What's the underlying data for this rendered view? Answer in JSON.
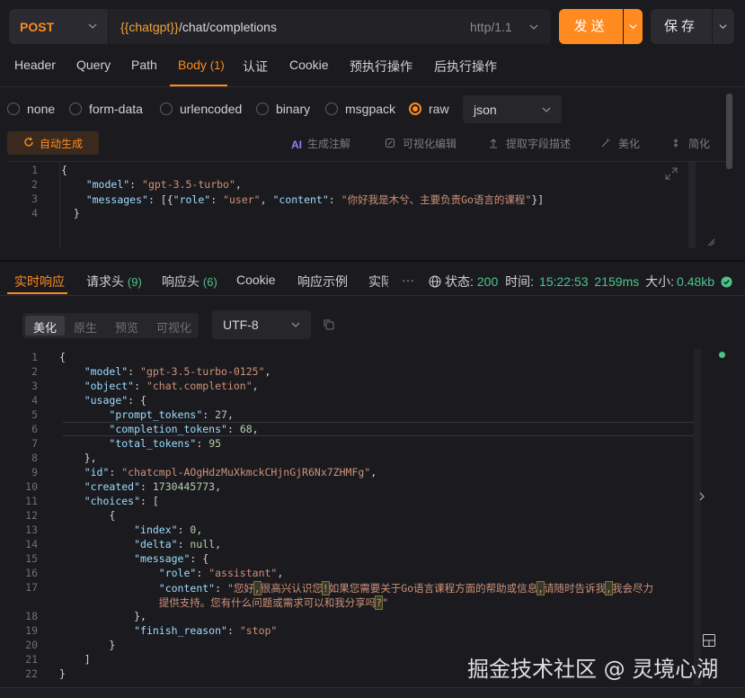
{
  "request": {
    "method": "POST",
    "url_variable": "{{chatgpt}}",
    "url_path": "/chat/completions",
    "http_version": "http/1.1",
    "send_label": "发送",
    "save_label": "保存"
  },
  "request_tabs": [
    {
      "label": "Header"
    },
    {
      "label": "Query"
    },
    {
      "label": "Path"
    },
    {
      "label": "Body",
      "count": "(1)",
      "active": true
    },
    {
      "label": "认证"
    },
    {
      "label": "Cookie"
    },
    {
      "label": "预执行操作"
    },
    {
      "label": "后执行操作"
    }
  ],
  "body_types": [
    "none",
    "form-data",
    "urlencoded",
    "binary",
    "msgpack",
    "raw"
  ],
  "body_type_selected": "raw",
  "body_format": "json",
  "body_tools": {
    "auto_generate": "自动生成",
    "ai_annotate": "生成注解",
    "visual_edit": "可视化编辑",
    "extract_fields": "提取字段描述",
    "beautify": "美化",
    "minify": "简化"
  },
  "request_body_lines": [
    {
      "n": "1",
      "html": "<span class='p'>{</span>"
    },
    {
      "n": "2",
      "html": "    <span class='k'>\"model\"</span><span class='p'>: </span><span class='s'>\"gpt-3.5-turbo\"</span><span class='p'>,</span>"
    },
    {
      "n": "3",
      "html": "    <span class='k'>\"messages\"</span><span class='p'>: [{</span><span class='k'>\"role\"</span><span class='p'>: </span><span class='s'>\"user\"</span><span class='p'>, </span><span class='k'>\"content\"</span><span class='p'>: </span><span class='s'>\"你好我是木兮、主要负责Go语言的课程\"</span><span class='p'>}]</span>"
    },
    {
      "n": "4",
      "html": "  <span class='p'>}</span>"
    }
  ],
  "response_tabs": [
    {
      "label": "实时响应",
      "active": true
    },
    {
      "label": "请求头",
      "count": "(9)"
    },
    {
      "label": "响应头",
      "count": "(6)"
    },
    {
      "label": "Cookie"
    },
    {
      "label": "响应示例"
    },
    {
      "label": "实际"
    }
  ],
  "response_status": {
    "status_label": "状态:",
    "status_value": "200",
    "time_label": "时间:",
    "time_value": "15:22:53",
    "duration": "2159ms",
    "size_label": "大小:",
    "size_value": "0.48kb"
  },
  "response_view_modes": [
    "美化",
    "原生",
    "预览",
    "可视化"
  ],
  "response_view_selected": "美化",
  "response_encoding": "UTF-8",
  "response_lines": [
    {
      "n": "1",
      "html": "<span class='p'>{</span>"
    },
    {
      "n": "2",
      "html": "    <span class='k'>\"model\"</span><span class='p'>: </span><span class='s'>\"gpt-3.5-turbo-0125\"</span><span class='p'>,</span>"
    },
    {
      "n": "3",
      "html": "    <span class='k'>\"object\"</span><span class='p'>: </span><span class='s'>\"chat.completion\"</span><span class='p'>,</span>"
    },
    {
      "n": "4",
      "html": "    <span class='k'>\"usage\"</span><span class='p'>: {</span>"
    },
    {
      "n": "5",
      "html": "        <span class='k'>\"prompt_tokens\"</span><span class='p'>: </span><span class='n'>27</span><span class='p'>,</span>"
    },
    {
      "n": "6",
      "html": "        <span class='k'>\"completion_tokens\"</span><span class='p'>: </span><span class='n'>68</span><span class='p'>,</span>"
    },
    {
      "n": "7",
      "html": "        <span class='k'>\"total_tokens\"</span><span class='p'>: </span><span class='n'>95</span>"
    },
    {
      "n": "8",
      "html": "    <span class='p'>},</span>"
    },
    {
      "n": "9",
      "html": "    <span class='k'>\"id\"</span><span class='p'>: </span><span class='s'>\"chatcmpl-AOgHdzMuXkmckCHjnGjR6Nx7ZHMFg\"</span><span class='p'>,</span>"
    },
    {
      "n": "10",
      "html": "    <span class='k'>\"created\"</span><span class='p'>: </span><span class='n'>1730445773</span><span class='p'>,</span>"
    },
    {
      "n": "11",
      "html": "    <span class='k'>\"choices\"</span><span class='p'>: [</span>"
    },
    {
      "n": "12",
      "html": "        <span class='p'>{</span>"
    },
    {
      "n": "13",
      "html": "            <span class='k'>\"index\"</span><span class='p'>: </span><span class='n'>0</span><span class='p'>,</span>"
    },
    {
      "n": "14",
      "html": "            <span class='k'>\"delta\"</span><span class='p'>: </span><span class='n'>null</span><span class='p'>,</span>"
    },
    {
      "n": "15",
      "html": "            <span class='k'>\"message\"</span><span class='p'>: {</span>"
    },
    {
      "n": "16",
      "html": "                <span class='k'>\"role\"</span><span class='p'>: </span><span class='s'>\"assistant\"</span><span class='p'>,</span>"
    },
    {
      "n": "17",
      "html": "                <span class='k'>\"content\"</span><span class='p'>: </span><span class='s'>\"您好<span class='hl'>,</span>很高兴认识您<span class='hl'>!</span>如果您需要关于Go语言课程方面的帮助或信息<span class='hl'>,</span>请随时告诉我<span class='hl'>,</span>我会尽力</span>"
    },
    {
      "n": "",
      "html": "                <span class='s'>提供支持。您有什么问题或需求可以和我分享吗<span class='hl'>?</span>\"</span>"
    },
    {
      "n": "18",
      "html": "            <span class='p'>},</span>"
    },
    {
      "n": "19",
      "html": "            <span class='k'>\"finish_reason\"</span><span class='p'>: </span><span class='s'>\"stop\"</span>"
    },
    {
      "n": "20",
      "html": "        <span class='p'>}</span>"
    },
    {
      "n": "21",
      "html": "    <span class='p'>]</span>"
    },
    {
      "n": "22",
      "html": "<span class='p'>}</span>"
    }
  ],
  "watermark": "掘金技术社区 @ 灵境心湖",
  "colors": {
    "accent": "#ff8a1f",
    "success": "#4cc38a",
    "background": "#1b1b1f"
  },
  "icons": [
    "chevron-down-icon",
    "refresh-icon",
    "ai-icon",
    "edit-icon",
    "extract-icon",
    "magic-icon",
    "compress-icon",
    "expand-icon",
    "globe-icon",
    "check-circle-icon",
    "copy-icon",
    "chevron-right-icon",
    "layout-icon"
  ]
}
